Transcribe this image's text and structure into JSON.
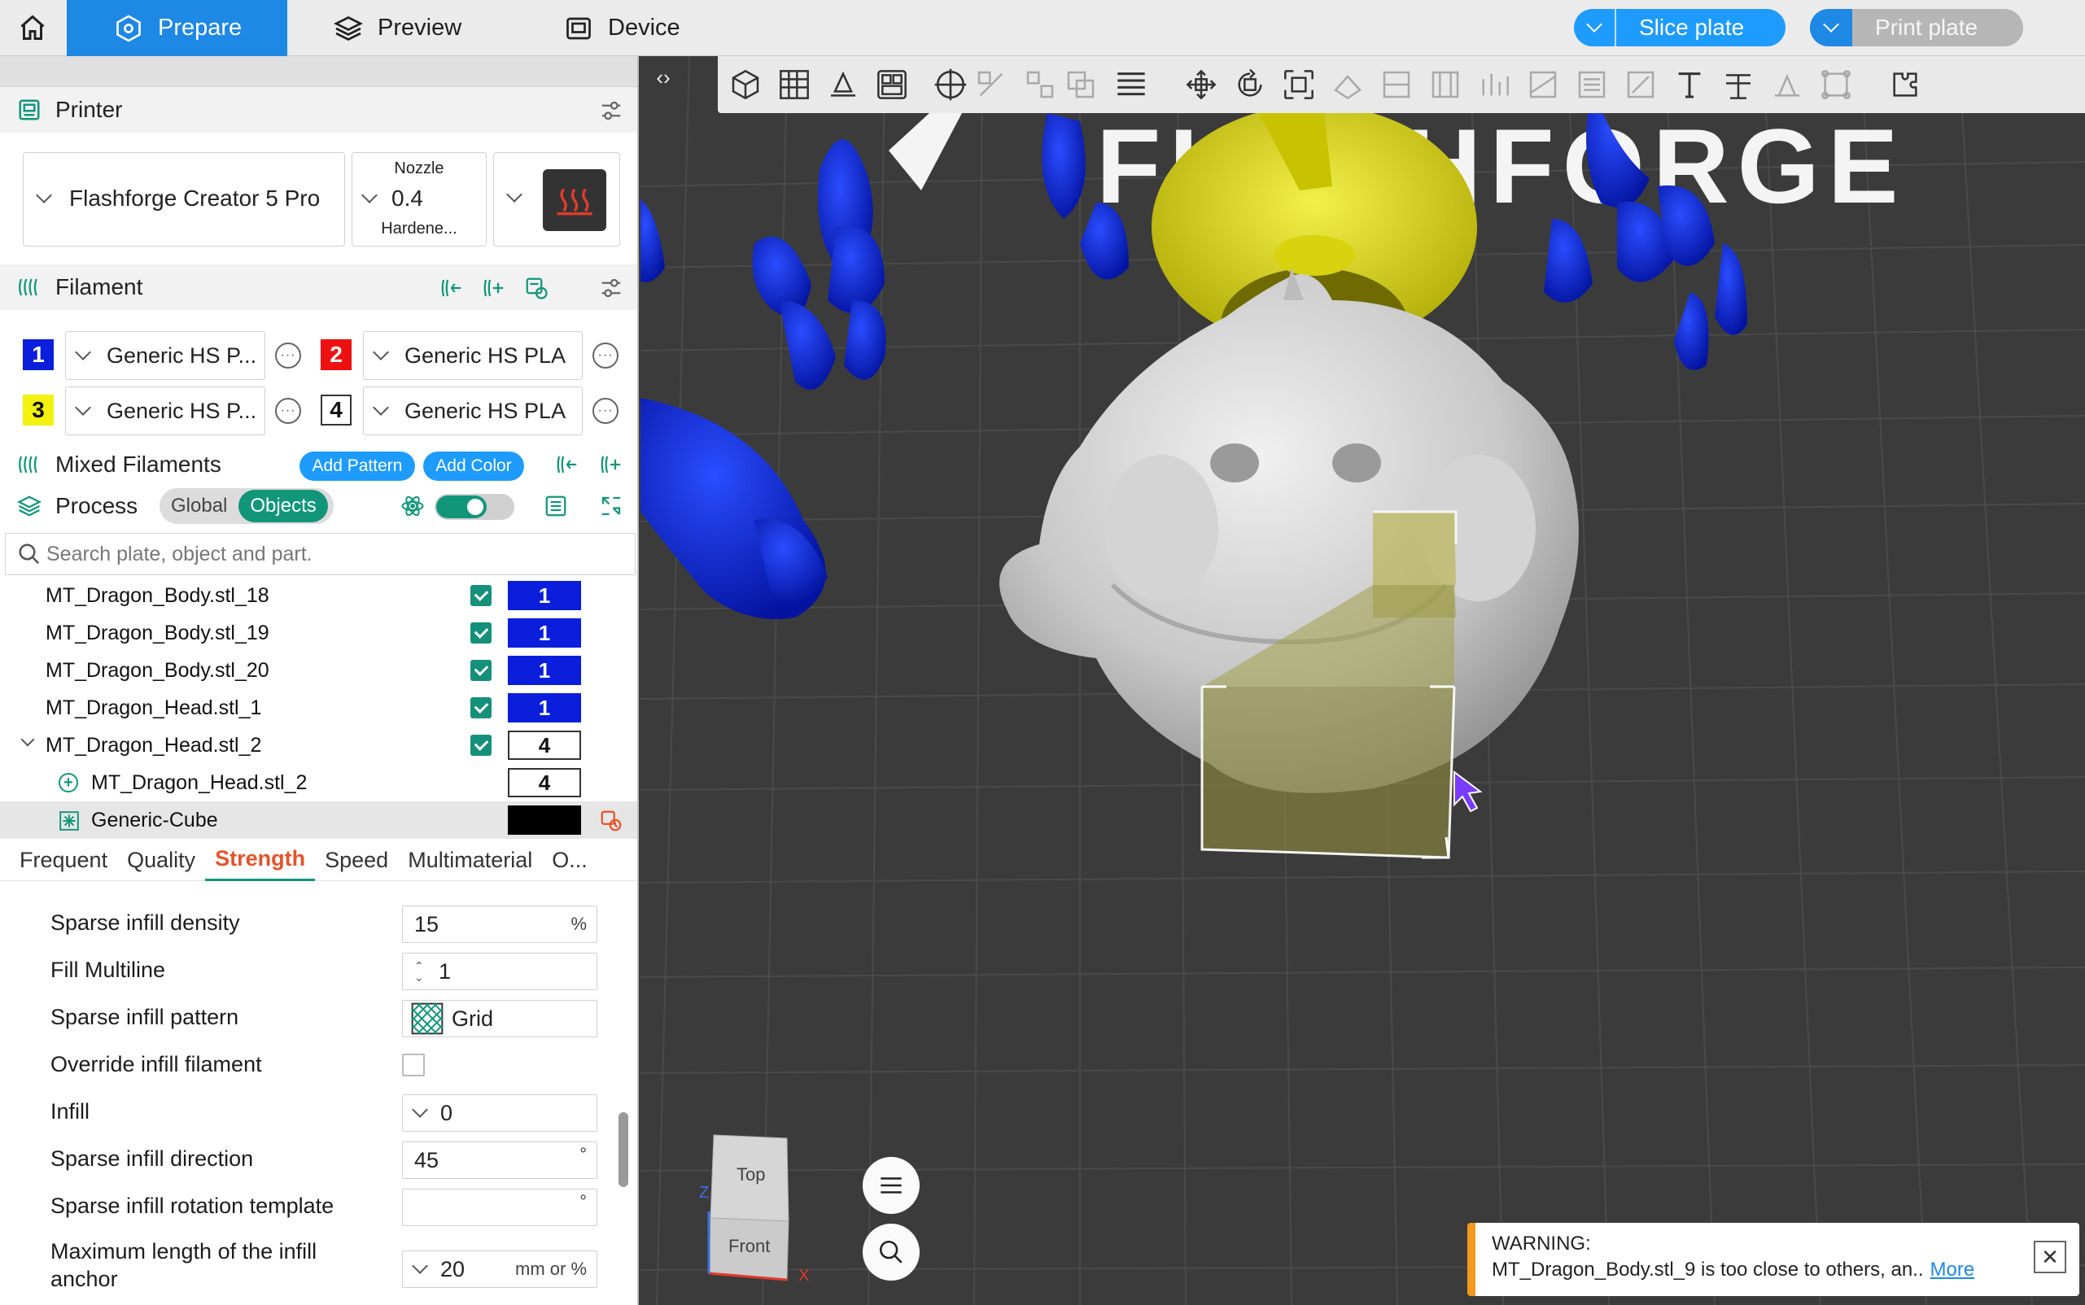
{
  "topbar": {
    "tabs": [
      {
        "label": "Prepare"
      },
      {
        "label": "Preview"
      },
      {
        "label": "Device"
      }
    ],
    "slice_label": "Slice plate",
    "print_label": "Print plate"
  },
  "printer": {
    "section_title": "Printer",
    "model": "Flashforge Creator 5 Pro",
    "nozzle_title": "Nozzle",
    "nozzle_size": "0.4",
    "nozzle_type": "Hardene..."
  },
  "filament": {
    "section_title": "Filament",
    "slots": [
      {
        "num": "1",
        "name": "Generic HS P...",
        "color": "#0a1edc"
      },
      {
        "num": "2",
        "name": "Generic HS PLA",
        "color": "#ee1111"
      },
      {
        "num": "3",
        "name": "Generic HS P...",
        "color": "#f2f20e"
      },
      {
        "num": "4",
        "name": "Generic HS PLA",
        "color": "#ffffff"
      }
    ]
  },
  "mixed": {
    "section_title": "Mixed Filaments",
    "add_pattern": "Add Pattern",
    "add_color": "Add Color"
  },
  "process": {
    "section_title": "Process",
    "seg_global": "Global",
    "seg_objects": "Objects"
  },
  "search": {
    "placeholder": "Search plate, object and part."
  },
  "objects": [
    {
      "name": "MT_Dragon_Body.stl_18",
      "filament": "1"
    },
    {
      "name": "MT_Dragon_Body.stl_19",
      "filament": "1"
    },
    {
      "name": "MT_Dragon_Body.stl_20",
      "filament": "1"
    },
    {
      "name": "MT_Dragon_Head.stl_1",
      "filament": "1"
    },
    {
      "name": "MT_Dragon_Head.stl_2",
      "filament": "4"
    },
    {
      "name": "MT_Dragon_Head.stl_2",
      "filament": "4"
    },
    {
      "name": "Generic-Cube",
      "filament": ""
    }
  ],
  "setting_tabs": [
    "Frequent",
    "Quality",
    "Strength",
    "Speed",
    "Multimaterial",
    "O..."
  ],
  "settings": [
    {
      "label": "Sparse infill density",
      "value": "15",
      "unit": "%"
    },
    {
      "label": "Fill Multiline",
      "value": "1",
      "unit": ""
    },
    {
      "label": "Sparse infill pattern",
      "value": "Grid",
      "unit": ""
    },
    {
      "label": "Override infill filament",
      "value": "",
      "unit": ""
    },
    {
      "label": "Infill",
      "value": "0",
      "unit": ""
    },
    {
      "label": "Sparse infill direction",
      "value": "45",
      "unit": "°"
    },
    {
      "label": "Sparse infill rotation template",
      "value": "",
      "unit": "°"
    },
    {
      "label": "Maximum length of the infill",
      "label2": "anchor",
      "value": "20",
      "unit": "mm or %"
    }
  ],
  "viewport": {
    "logo_text": "FLASHFORGE",
    "cube_top": "Top",
    "cube_front": "Front",
    "axis_x": "X",
    "axis_z": "Z"
  },
  "warning": {
    "title": "WARNING:",
    "message": "MT_Dragon_Body.stl_9 is too close to others, an..",
    "more": "More"
  },
  "colors": {
    "accent": "#1e88e5",
    "teal": "#11967a",
    "strength_tab": "#e2552a",
    "warning": "#f39a1e"
  }
}
